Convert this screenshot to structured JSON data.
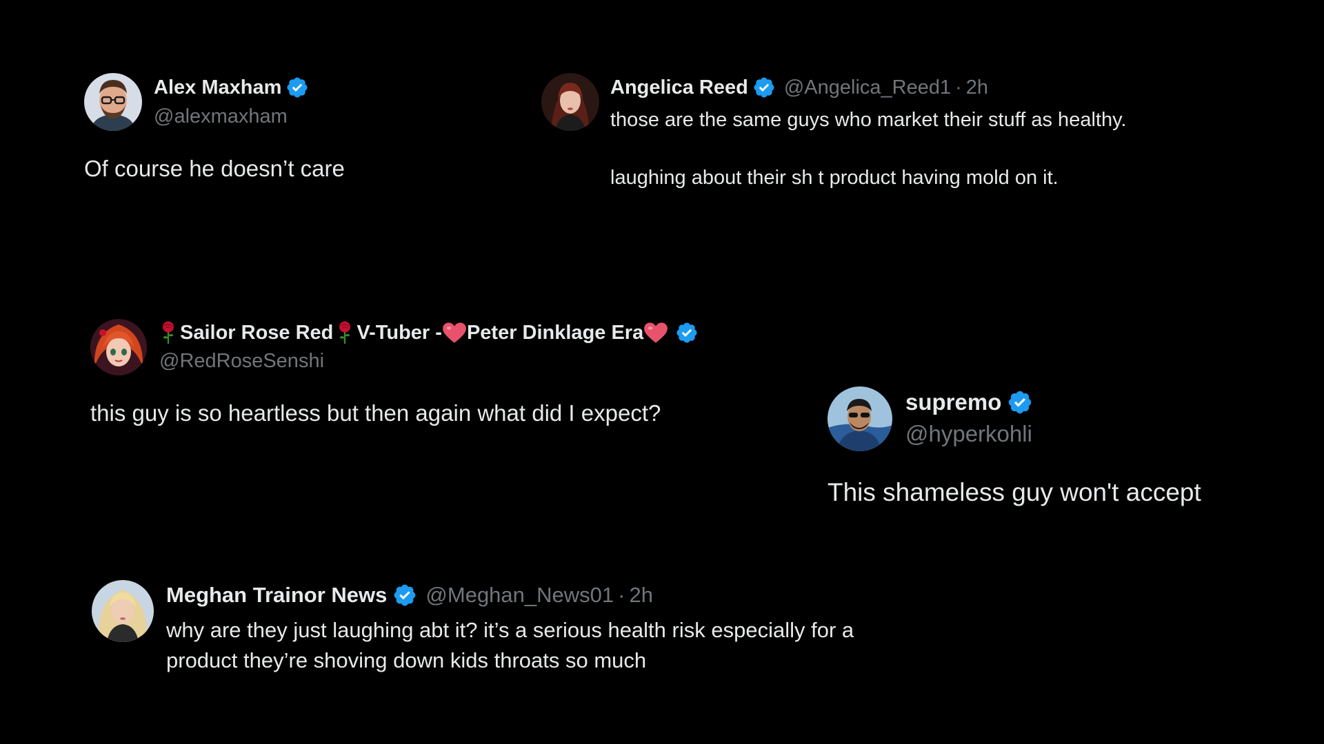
{
  "tweets": [
    {
      "name": "Alex Maxham",
      "handle": "@alexmaxham",
      "text": "Of course he doesn’t care"
    },
    {
      "name": "Angelica Reed",
      "handle": "@Angelica_Reed1",
      "separator": "·",
      "time": "2h",
      "text_line1": "those are the same guys who market their stuff as healthy.",
      "text_line2": "laughing about their sh t product having mold on it."
    },
    {
      "name_part1": "Sailor Rose Red",
      "name_part2": "V-Tuber -",
      "name_part3": "Peter Dinklage Era",
      "handle": "@RedRoseSenshi",
      "text": "this guy is so heartless but then again what did I expect?"
    },
    {
      "name": "supremo",
      "handle": "@hyperkohli",
      "text": "This shameless guy won't accept"
    },
    {
      "name": "Meghan Trainor News",
      "handle": "@Meghan_News01",
      "separator": "·",
      "time": "2h",
      "text_line1": "why are they just laughing abt it? it’s a serious health risk especially for a",
      "text_line2": "product they’re shoving down kids throats so much"
    }
  ],
  "icons": {
    "verified": "verified-badge-icon",
    "rose": "rose-emoji",
    "heart": "heart-emoji"
  },
  "colors": {
    "background": "#000000",
    "text": "#e7e9ea",
    "muted": "#71767b",
    "verified": "#1d9bf0"
  }
}
